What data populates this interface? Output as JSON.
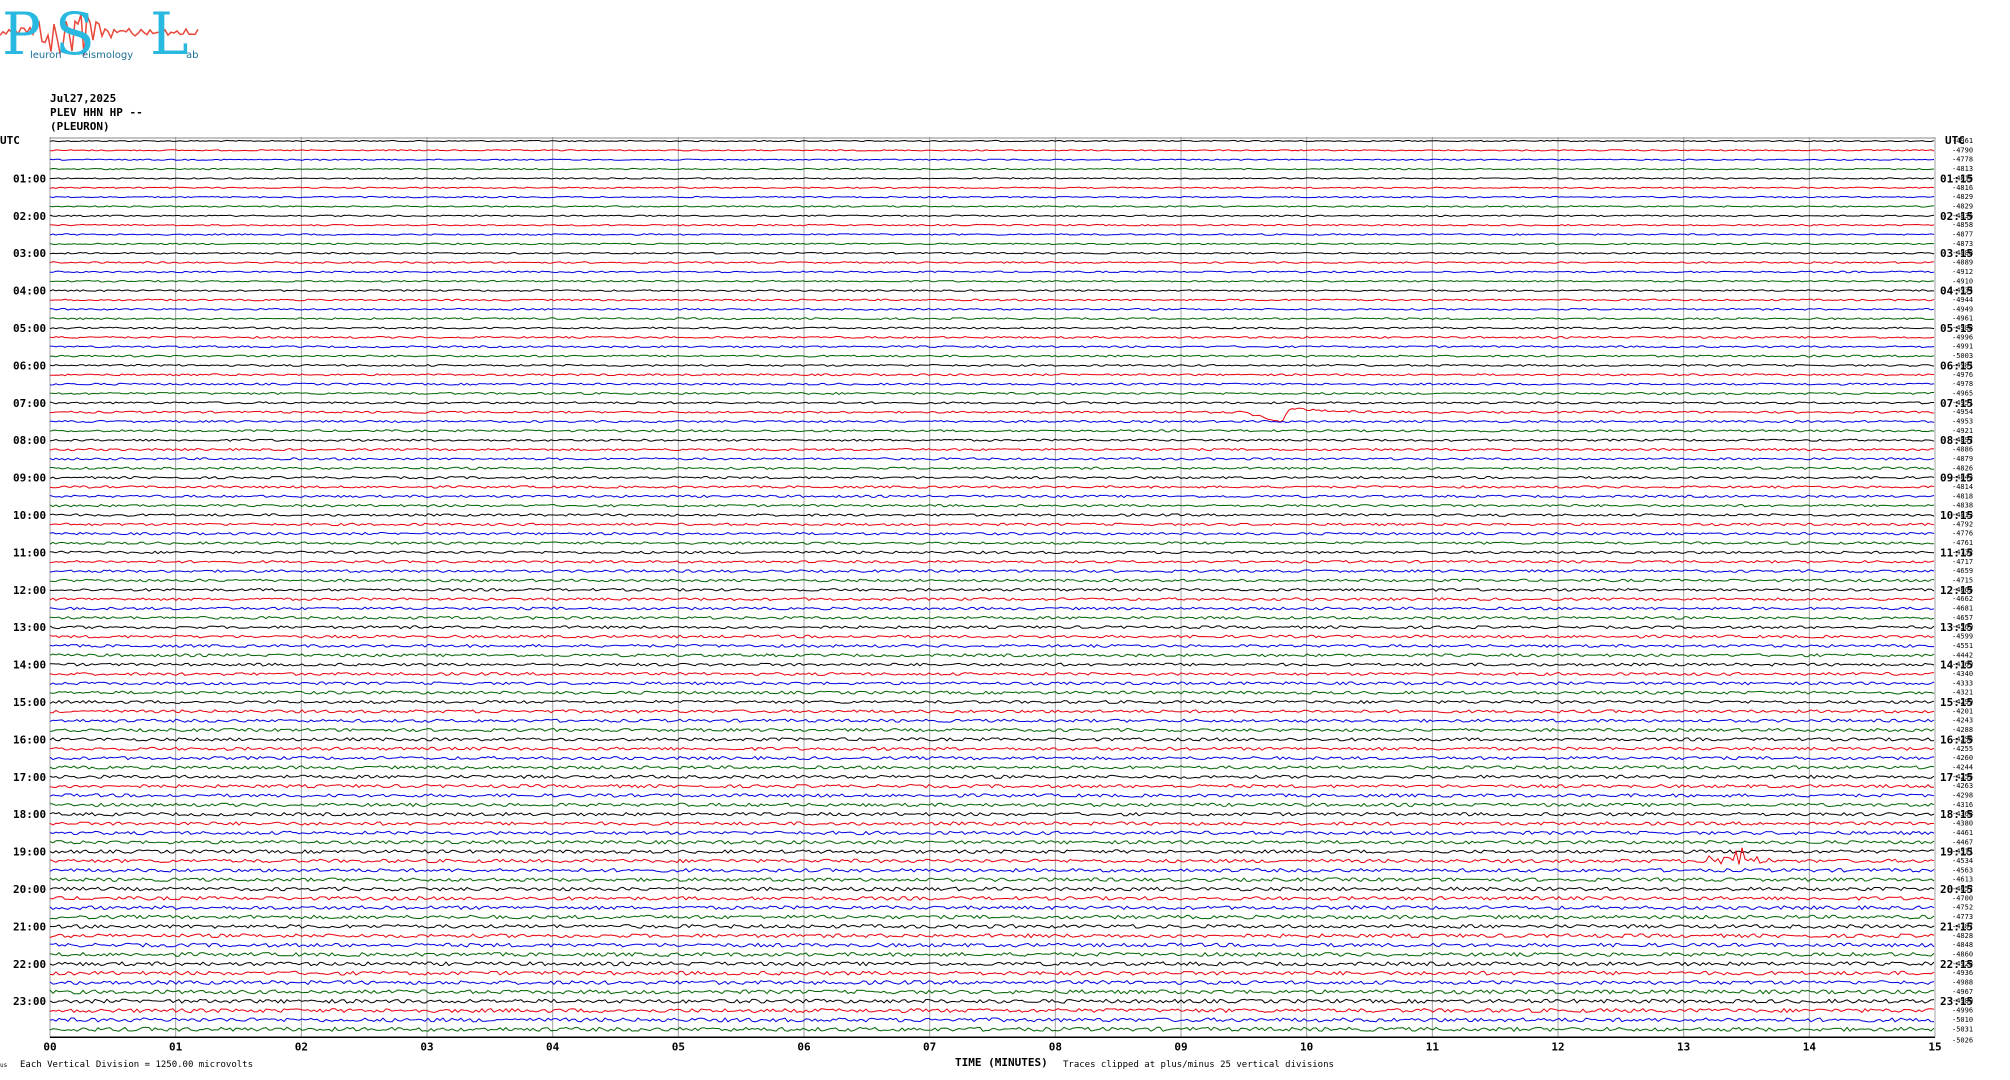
{
  "logo": {
    "letters": [
      "P",
      "S",
      "L"
    ],
    "words": [
      "leuron",
      "eismology",
      "ab"
    ],
    "color": "#29b8e0",
    "waveform_color": "#e8483a"
  },
  "header": {
    "date": "Jul27,2025",
    "station": "PLEV HHN HP --",
    "site": "(PLEURON)"
  },
  "chart_data": {
    "type": "line",
    "title": "",
    "xlabel": "TIME (MINUTES)",
    "x_ticks": [
      "00",
      "01",
      "02",
      "03",
      "04",
      "05",
      "06",
      "07",
      "08",
      "09",
      "10",
      "11",
      "12",
      "13",
      "14",
      "15"
    ],
    "xlim": [
      0,
      15
    ],
    "left_axis_label": "UTC",
    "right_axis_label": "UTC",
    "left_hour_labels": [
      "01:00",
      "02:00",
      "03:00",
      "04:00",
      "05:00",
      "06:00",
      "07:00",
      "08:00",
      "09:00",
      "10:00",
      "11:00",
      "12:00",
      "13:00",
      "14:00",
      "15:00",
      "16:00",
      "17:00",
      "18:00",
      "19:00",
      "20:00",
      "21:00",
      "22:00",
      "23:00"
    ],
    "right_hour_labels": [
      "01:15",
      "02:15",
      "03:15",
      "04:15",
      "05:15",
      "06:15",
      "07:15",
      "08:15",
      "09:15",
      "10:15",
      "11:15",
      "12:15",
      "13:15",
      "14:15",
      "15:15",
      "16:15",
      "17:15",
      "18:15",
      "19:15",
      "20:15",
      "21:15",
      "22:15",
      "23:15"
    ],
    "trace_minutes": 15,
    "trace_count": 96,
    "trace_colors": [
      "#000000",
      "#e8000b",
      "#0000e0",
      "#006400"
    ],
    "trace_offsets": [
      "-4961",
      "-4790",
      "-4778",
      "-4813",
      "-4815",
      "-4816",
      "-4829",
      "-4829",
      "-4836",
      "-4858",
      "-4877",
      "-4873",
      "-4888",
      "-4889",
      "-4912",
      "-4910",
      "-4934",
      "-4944",
      "-4949",
      "-4961",
      "-4988",
      "-4996",
      "-4991",
      "-5003",
      "-4981",
      "-4976",
      "-4978",
      "-4965",
      "-4951",
      "-4954",
      "-4953",
      "-4921",
      "-4897",
      "-4886",
      "-4879",
      "-4826",
      "-4843",
      "-4814",
      "-4818",
      "-4838",
      "-4813",
      "-4792",
      "-4776",
      "-4761",
      "-4732",
      "-4717",
      "-4659",
      "-4715",
      "-4665",
      "-4662",
      "-4681",
      "-4657",
      "-4569",
      "-4599",
      "-4551",
      "-4442",
      "-4369",
      "-4340",
      "-4333",
      "-4321",
      "-4299",
      "-4201",
      "-4243",
      "-4288",
      "-4258",
      "-4255",
      "-4260",
      "-4244",
      "-4255",
      "-4263",
      "-4298",
      "-4316",
      "-4368",
      "-4380",
      "-4461",
      "-4467",
      "-4511",
      "-4534",
      "-4563",
      "-4613",
      "-4657",
      "-4700",
      "-4752",
      "-4773",
      "-4787",
      "-4828",
      "-4848",
      "-4860",
      "-4928",
      "-4936",
      "-4988",
      "-4967",
      "-4980",
      "-4996",
      "-5010",
      "-5031"
    ],
    "last_offset": "-5026",
    "events": [
      {
        "trace_hour": "07:15",
        "minute_start": 9.5,
        "minute_end": 11.0,
        "description": "step"
      },
      {
        "trace_hour": "19:15",
        "minute_start": 13.2,
        "minute_end": 14.0,
        "description": "earthquake"
      }
    ],
    "clip_divisions": 25,
    "grid": true
  },
  "footer": {
    "scale_note": "Each Vertical Division = 1250.00 microvolts",
    "clip_note": "Traces clipped at plus/minus 25 vertical divisions",
    "corner_mark": "us"
  }
}
